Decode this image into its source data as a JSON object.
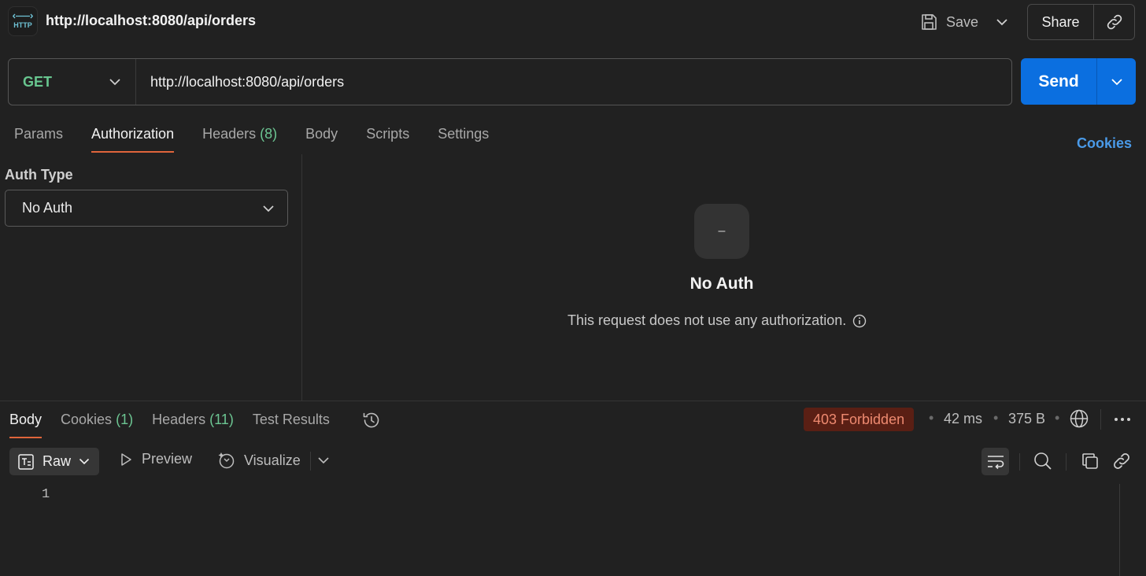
{
  "header": {
    "title": "http://localhost:8080/api/orders",
    "http_icon_text": "HTTP",
    "save_label": "Save",
    "share_label": "Share"
  },
  "request": {
    "method": "GET",
    "url": "http://localhost:8080/api/orders",
    "send_label": "Send",
    "method_color": "#68c68f",
    "send_color": "#0b6fe0"
  },
  "request_tabs": {
    "params": "Params",
    "authorization": "Authorization",
    "headers": "Headers",
    "headers_count": "(8)",
    "body": "Body",
    "scripts": "Scripts",
    "settings": "Settings",
    "active": "Authorization",
    "cookies_link": "Cookies"
  },
  "auth": {
    "type_label": "Auth Type",
    "selected": "No Auth",
    "tile_glyph": "–",
    "title": "No Auth",
    "description": "This request does not use any authorization."
  },
  "response_tabs": {
    "body": "Body",
    "cookies": "Cookies",
    "cookies_count": "(1)",
    "headers": "Headers",
    "headers_count": "(11)",
    "test_results": "Test Results",
    "active": "Body"
  },
  "response_meta": {
    "status": "403 Forbidden",
    "time": "42 ms",
    "size": "375 B",
    "status_bg": "#5a1f14",
    "status_fg": "#ee8a70"
  },
  "response_toolbar": {
    "format": "Raw",
    "preview": "Preview",
    "visualize": "Visualize"
  },
  "editor": {
    "line_numbers": [
      "1"
    ]
  }
}
